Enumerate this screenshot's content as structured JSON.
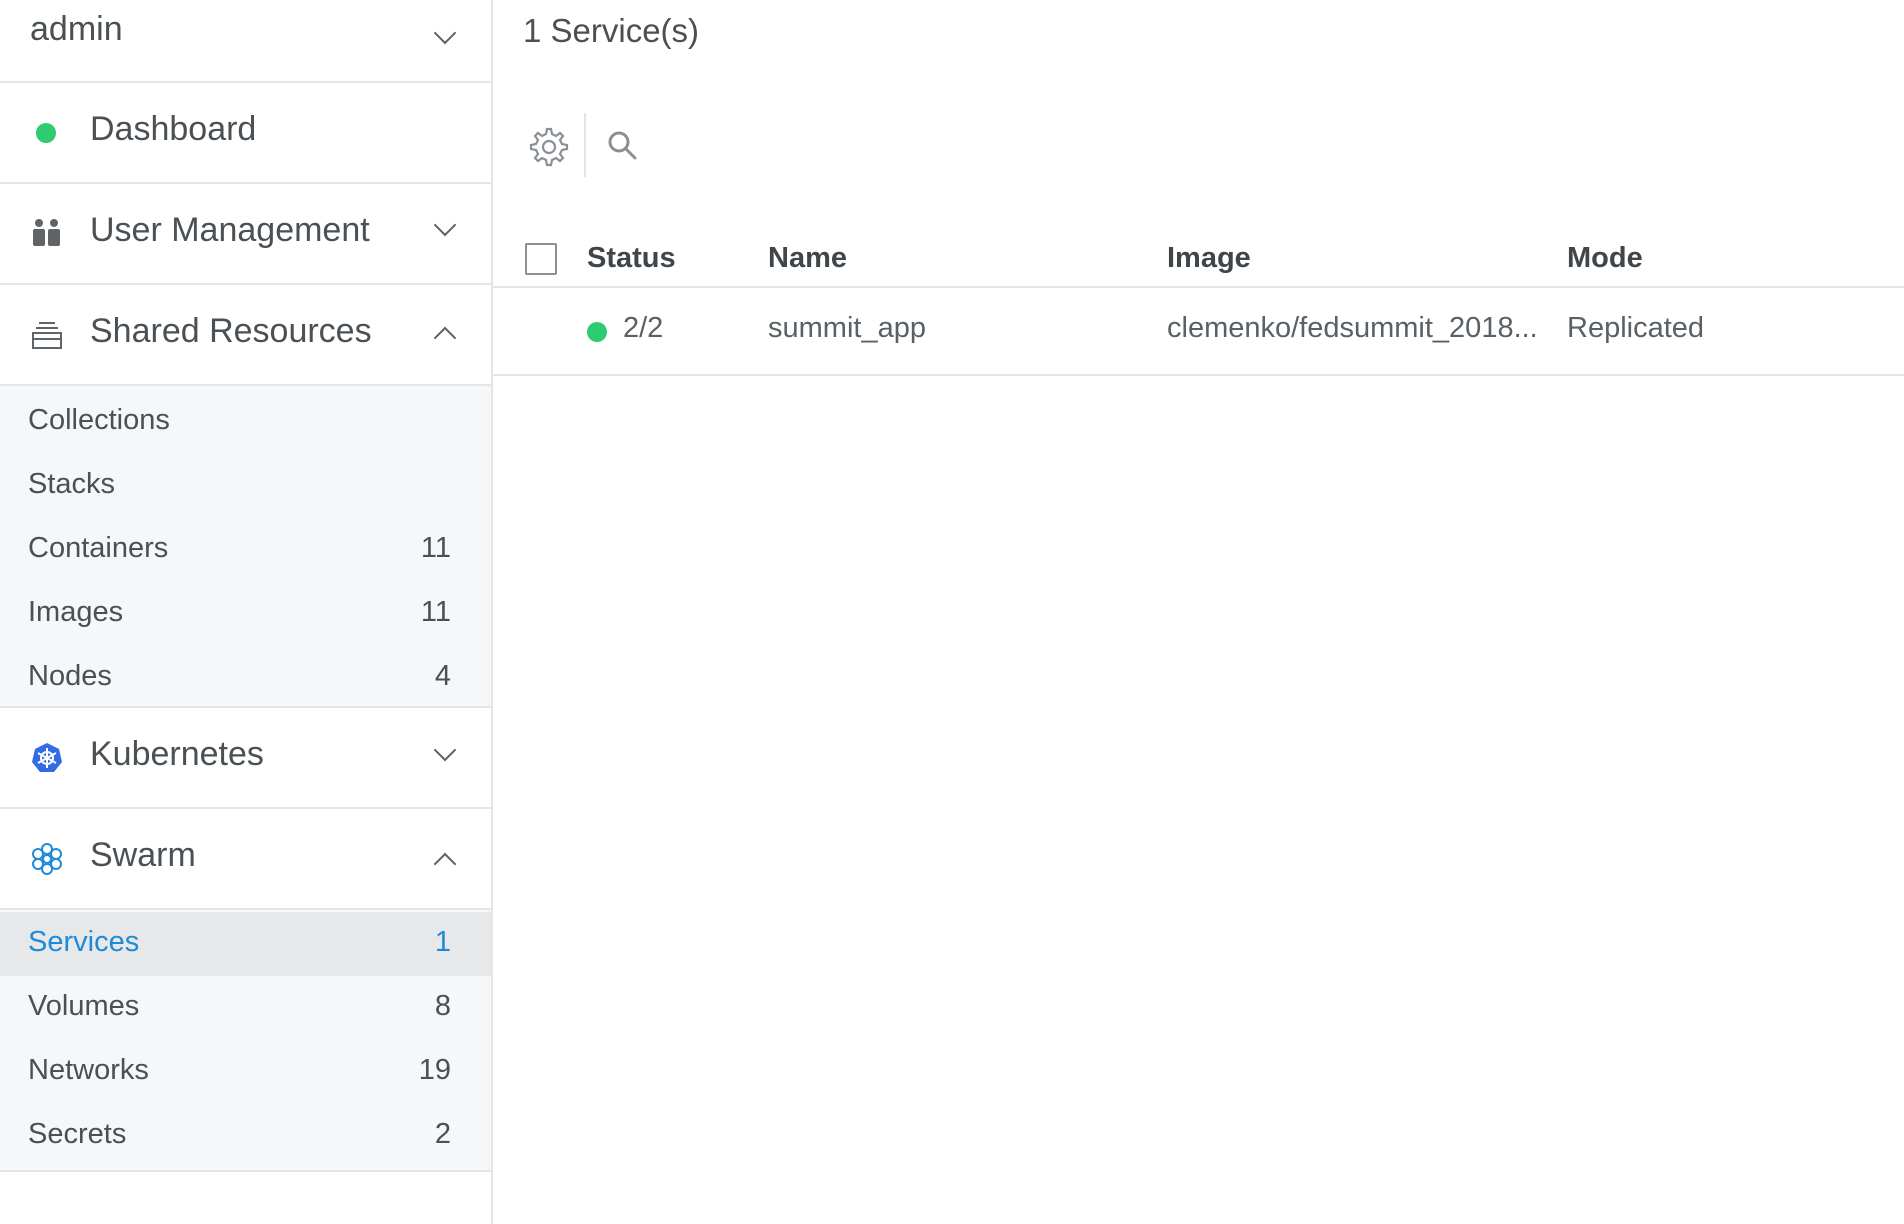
{
  "account": {
    "name": "admin"
  },
  "nav": {
    "dashboard": {
      "label": "Dashboard",
      "status_color": "#2ecc71"
    },
    "user_management": {
      "label": "User Management"
    },
    "shared_resources": {
      "label": "Shared Resources",
      "items": [
        {
          "label": "Collections",
          "count": ""
        },
        {
          "label": "Stacks",
          "count": ""
        },
        {
          "label": "Containers",
          "count": "11"
        },
        {
          "label": "Images",
          "count": "11"
        },
        {
          "label": "Nodes",
          "count": "4"
        }
      ]
    },
    "kubernetes": {
      "label": "Kubernetes",
      "icon_color": "#326ce5"
    },
    "swarm": {
      "label": "Swarm",
      "icon_color": "#1f8ad6",
      "items": [
        {
          "label": "Services",
          "count": "1",
          "active": true
        },
        {
          "label": "Volumes",
          "count": "8"
        },
        {
          "label": "Networks",
          "count": "19"
        },
        {
          "label": "Secrets",
          "count": "2"
        }
      ]
    }
  },
  "main": {
    "title": "1 Service(s)",
    "table": {
      "columns": [
        "Status",
        "Name",
        "Image",
        "Mode"
      ],
      "rows": [
        {
          "status": "2/2",
          "status_color": "#2ecc71",
          "name": "summit_app",
          "image": "clemenko/fedsummit_2018...",
          "mode": "Replicated"
        }
      ]
    }
  },
  "colors": {
    "accent": "#1f8ad6",
    "ok": "#2ecc71"
  }
}
